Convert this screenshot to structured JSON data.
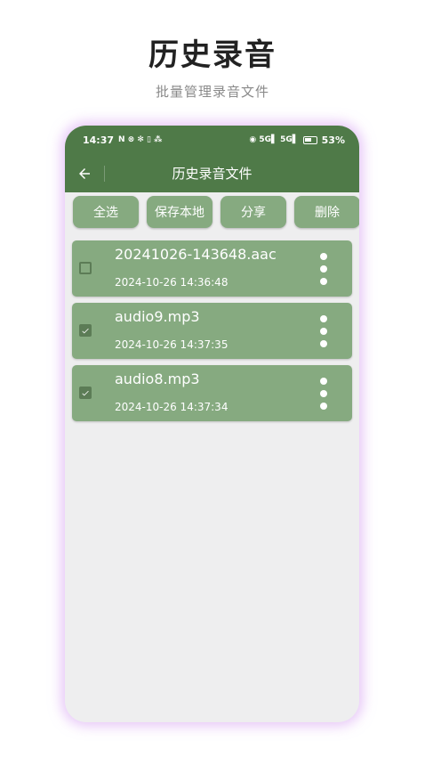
{
  "promo": {
    "title": "历史录音",
    "subtitle": "批量管理录音文件"
  },
  "status_bar": {
    "time": "14:37",
    "left_icons": "N ⊗ ✻ ▯ ⁂",
    "right_icons": "◉ 5G▌ 5G▌",
    "battery": "53%"
  },
  "app_bar": {
    "title": "历史录音文件",
    "back_icon": "arrow-left-icon"
  },
  "toolbar": {
    "select_all_label": "全选",
    "save_local_label": "保存本地",
    "share_label": "分享",
    "delete_label": "删除"
  },
  "files": [
    {
      "name": "20241026-143648.aac",
      "date": "2024-10-26 14:36:48",
      "checked": false
    },
    {
      "name": "audio9.mp3",
      "date": "2024-10-26 14:37:35",
      "checked": true
    },
    {
      "name": "audio8.mp3",
      "date": "2024-10-26 14:37:34",
      "checked": true
    }
  ],
  "colors": {
    "primary": "#4f7a48",
    "card": "#86aa80",
    "checkbox": "#5c7c56",
    "background": "#eeeeef"
  }
}
